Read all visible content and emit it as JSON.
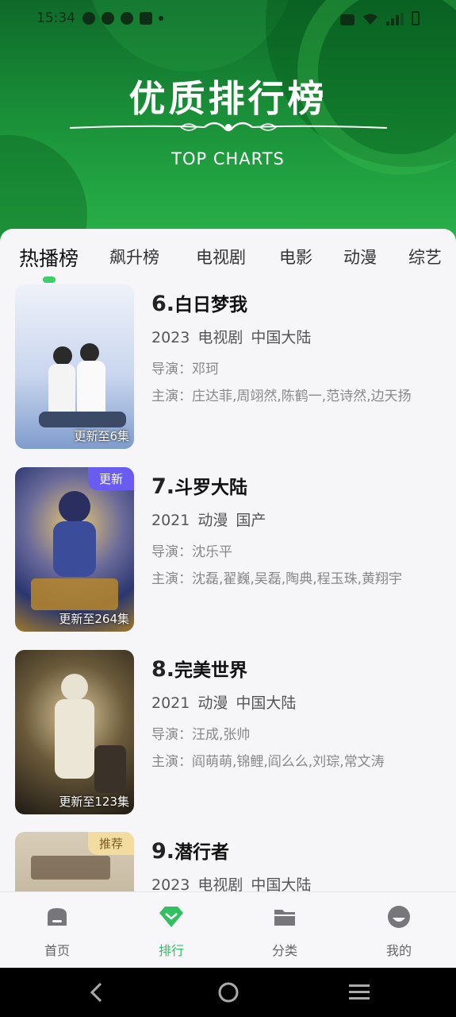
{
  "status_bar": {
    "time": "15:34"
  },
  "header": {
    "title": "优质排行榜",
    "subtitle": "TOP CHARTS"
  },
  "tabs": [
    {
      "label": "热播榜",
      "active": true
    },
    {
      "label": "飙升榜"
    },
    {
      "label": "电视剧"
    },
    {
      "label": "电影"
    },
    {
      "label": "动漫"
    },
    {
      "label": "综艺"
    }
  ],
  "items": [
    {
      "rank": "6.",
      "title": "白日梦我",
      "year": "2023",
      "type": "电视剧",
      "region": "中国大陆",
      "director": "导演：邓珂",
      "cast": "主演：庄达菲,周翊然,陈鹤一,范诗然,边天扬",
      "episodes": "更新至6集",
      "badge": "",
      "colors": [
        "#e9eef7",
        "#8fb2e6"
      ]
    },
    {
      "rank": "7.",
      "title": "斗罗大陆",
      "year": "2021",
      "type": "动漫",
      "region": "国产",
      "director": "导演：沈乐平",
      "cast": "主演：沈磊,翟巍,吴磊,陶典,程玉珠,黄翔宇",
      "episodes": "更新至264集",
      "badge": "更新",
      "colors": [
        "#2d3d79",
        "#d9b054"
      ]
    },
    {
      "rank": "8.",
      "title": "完美世界",
      "year": "2021",
      "type": "动漫",
      "region": "中国大陆",
      "director": "导演：汪成,张帅",
      "cast": "主演：阎萌萌,锦鲤,阎么么,刘琮,常文涛",
      "episodes": "更新至123集",
      "badge": "",
      "colors": [
        "#2a241c",
        "#b59a5a"
      ]
    },
    {
      "rank": "9.",
      "title": "潜行者",
      "year": "2023",
      "type": "电视剧",
      "region": "中国大陆",
      "director": "",
      "cast": "",
      "episodes": "",
      "badge": "推荐",
      "colors": [
        "#c9bba5",
        "#8a7860"
      ]
    }
  ],
  "bottom_nav": [
    {
      "label": "首页",
      "icon": "home-icon"
    },
    {
      "label": "排行",
      "icon": "rank-diamond-icon",
      "active": true
    },
    {
      "label": "分类",
      "icon": "folder-icon"
    },
    {
      "label": "我的",
      "icon": "profile-icon"
    }
  ],
  "colors": {
    "accent": "#32c062",
    "update_badge": "#6a5cf0",
    "recommend_badge": "#f2dca0",
    "header_green": "#1a8f38"
  }
}
